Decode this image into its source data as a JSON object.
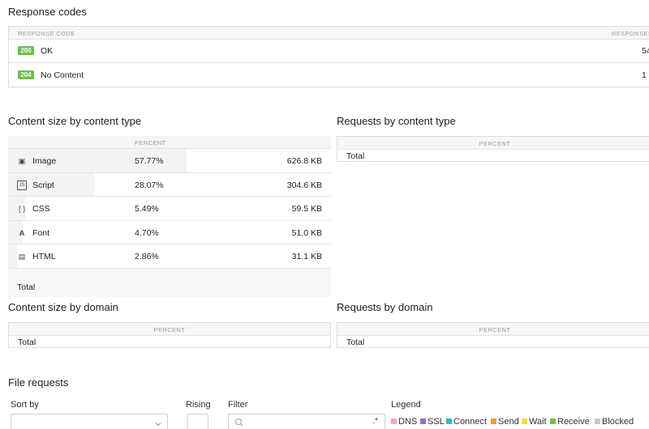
{
  "response_codes": {
    "title": "Response codes",
    "col_code": "RESPONSE CODE",
    "col_responses": "RESPONSES",
    "rows": [
      {
        "code": "200",
        "label": "OK",
        "count": "54"
      },
      {
        "code": "204",
        "label": "No Content",
        "count": "1"
      }
    ]
  },
  "content_size_type": {
    "title": "Content size by content type",
    "col_percent": "PERCENT",
    "rows": [
      {
        "icon": "image-icon",
        "glyph": "▣",
        "name": "Image",
        "percent": "57.77%",
        "size": "626.8 KB",
        "fraction": 0.5777
      },
      {
        "icon": "script-icon",
        "glyph": "JS",
        "name": "Script",
        "percent": "28.07%",
        "size": "304.6 KB",
        "fraction": 0.2807
      },
      {
        "icon": "css-icon",
        "glyph": "{ }",
        "name": "CSS",
        "percent": "5.49%",
        "size": "59.5 KB",
        "fraction": 0.0549
      },
      {
        "icon": "font-icon",
        "glyph": "A",
        "name": "Font",
        "percent": "4.70%",
        "size": "51.0 KB",
        "fraction": 0.047
      },
      {
        "icon": "html-icon",
        "glyph": "▤",
        "name": "HTML",
        "percent": "2.86%",
        "size": "31.1 KB",
        "fraction": 0.0286
      }
    ],
    "total_label": "Total"
  },
  "requests_type": {
    "title": "Requests by content type",
    "col_percent": "PERCENT",
    "total_label": "Total"
  },
  "content_size_domain": {
    "title": "Content size by domain",
    "col_percent": "PERCENT",
    "total_label": "Total"
  },
  "requests_domain": {
    "title": "Requests by domain",
    "col_percent": "PERCENT",
    "total_label": "Total"
  },
  "file_requests": {
    "title": "File requests",
    "sort_by_label": "Sort by",
    "rising_label": "Rising",
    "filter_label": "Filter",
    "filter_regex": ".*",
    "legend_label": "Legend",
    "legend": [
      {
        "name": "DNS",
        "color": "#f4a3c9"
      },
      {
        "name": "SSL",
        "color": "#9b6fc1"
      },
      {
        "name": "Connect",
        "color": "#2bbcd4"
      },
      {
        "name": "Send",
        "color": "#e8a23a"
      },
      {
        "name": "Wait",
        "color": "#f5de3a"
      },
      {
        "name": "Receive",
        "color": "#7cc43a"
      },
      {
        "name": "Blocked",
        "color": "#c8c8c8"
      }
    ]
  }
}
